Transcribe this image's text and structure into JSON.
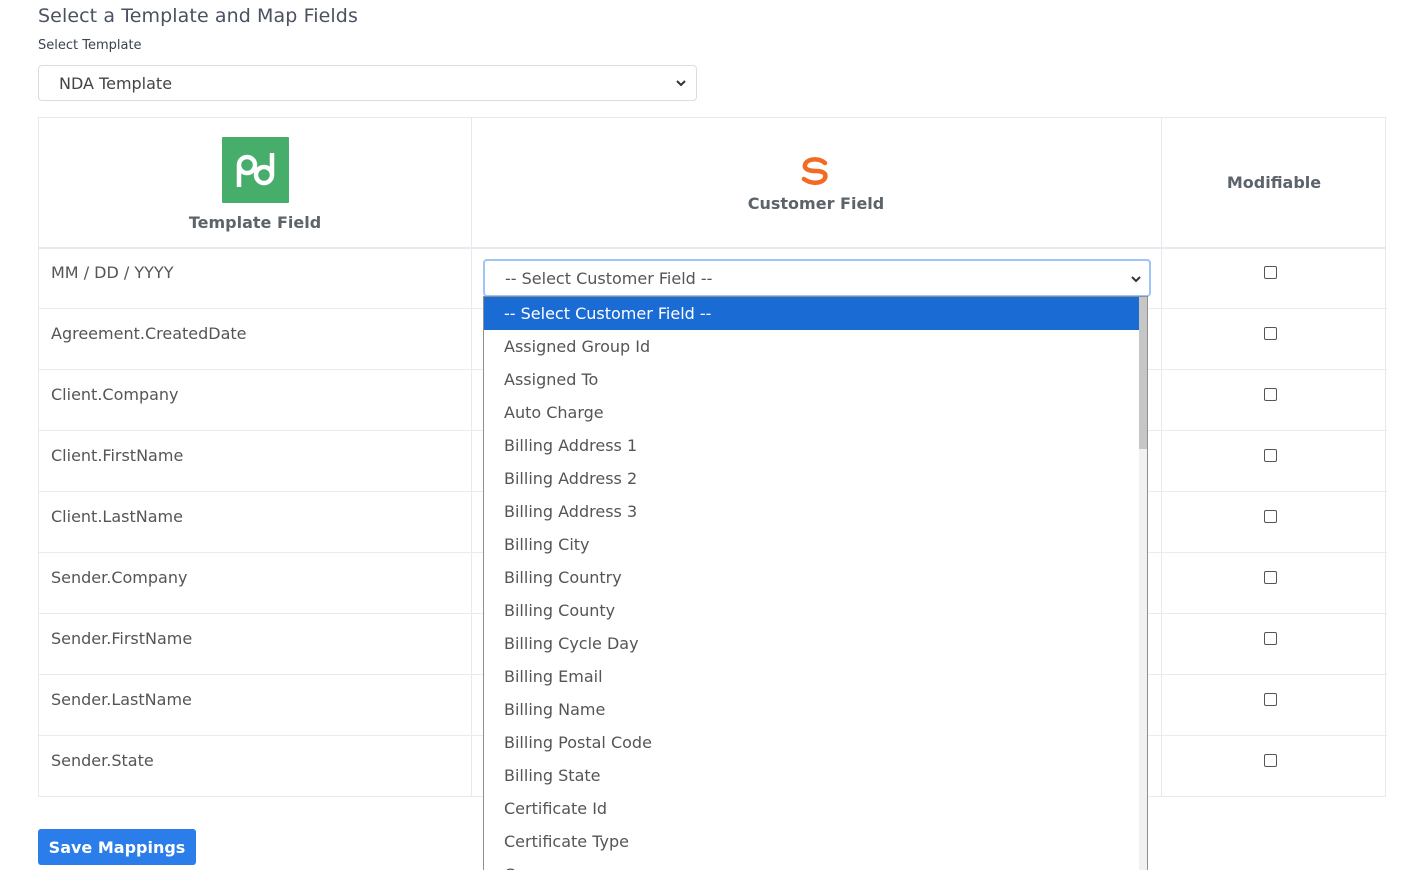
{
  "page": {
    "title": "Select a Template and Map Fields",
    "select_template_label": "Select Template",
    "template_value": "NDA Template"
  },
  "table": {
    "col_template": "Template Field",
    "col_customer": "Customer Field",
    "col_modifiable": "Modifiable",
    "rows": [
      {
        "field": "MM / DD / YYYY",
        "modifiable": false
      },
      {
        "field": "Agreement.CreatedDate",
        "modifiable": false
      },
      {
        "field": "Client.Company",
        "modifiable": false
      },
      {
        "field": "Client.FirstName",
        "modifiable": false
      },
      {
        "field": "Client.LastName",
        "modifiable": false
      },
      {
        "field": "Sender.Company",
        "modifiable": false
      },
      {
        "field": "Sender.FirstName",
        "modifiable": false
      },
      {
        "field": "Sender.LastName",
        "modifiable": false
      },
      {
        "field": "Sender.State",
        "modifiable": false
      }
    ]
  },
  "customer_select": {
    "value": "-- Select Customer Field --",
    "options": [
      "-- Select Customer Field --",
      "Assigned Group Id",
      "Assigned To",
      "Auto Charge",
      "Billing Address 1",
      "Billing Address 2",
      "Billing Address 3",
      "Billing City",
      "Billing Country",
      "Billing County",
      "Billing Cycle Day",
      "Billing Email",
      "Billing Name",
      "Billing Postal Code",
      "Billing State",
      "Certificate Id",
      "Certificate Type",
      "C"
    ]
  },
  "save_label": "Save Mappings",
  "colors": {
    "primary": "#2b7de9",
    "selected_option": "#1a6bd4",
    "pandadoc_green": "#47ad6b",
    "swirl_orange": "#f26b21"
  }
}
